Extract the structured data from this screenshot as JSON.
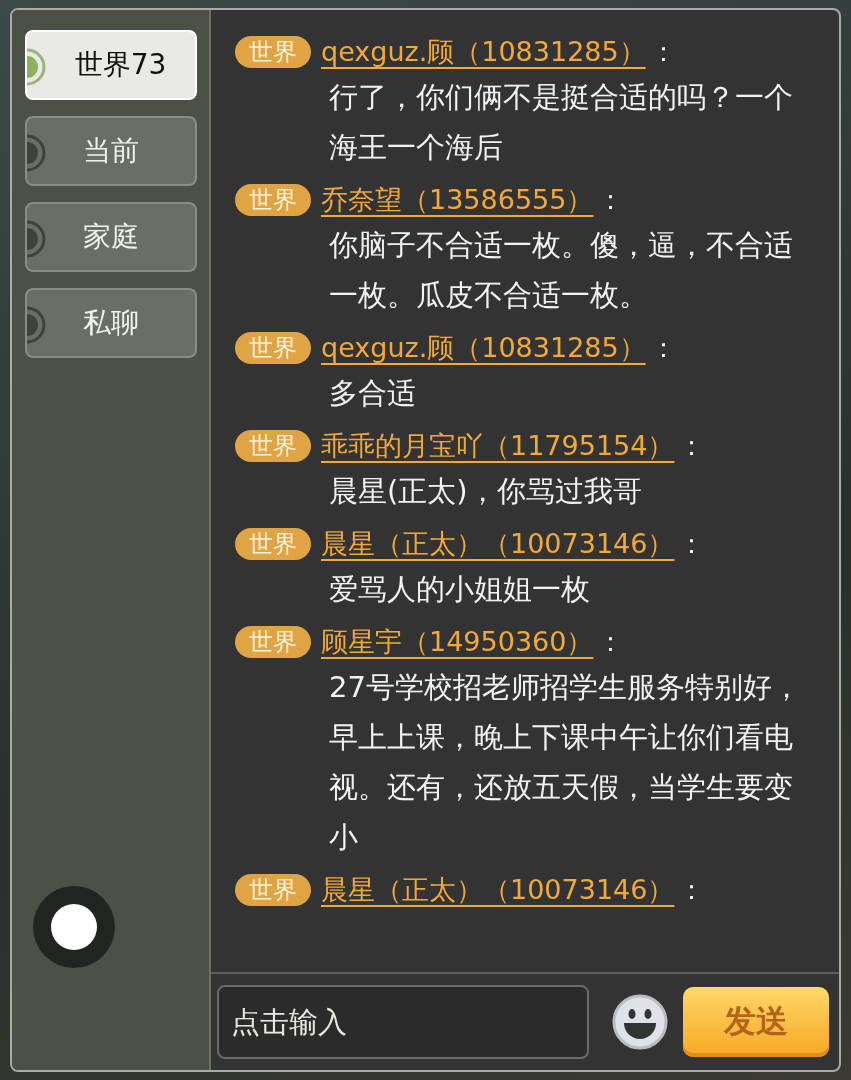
{
  "tabs": [
    {
      "label": "世界73",
      "selected": true
    },
    {
      "label": "当前",
      "selected": false
    },
    {
      "label": "家庭",
      "selected": false
    },
    {
      "label": "私聊",
      "selected": false
    }
  ],
  "messages": [
    {
      "channel": "世界",
      "sender": "qexguz.顾（10831285）",
      "colon": "：",
      "text": "行了，你们俩不是挺合适的吗？一个海王一个海后"
    },
    {
      "channel": "世界",
      "sender": "乔奈望（13586555）",
      "colon": "：",
      "text": "你脑子不合适一枚。傻，逼，不合适一枚。瓜皮不合适一枚。"
    },
    {
      "channel": "世界",
      "sender": "qexguz.顾（10831285）",
      "colon": "：",
      "text": "多合适"
    },
    {
      "channel": "世界",
      "sender": "乖乖的月宝吖（11795154）",
      "colon": "：",
      "text": "晨星(正太)，你骂过我哥"
    },
    {
      "channel": "世界",
      "sender": "晨星（正太）（10073146）",
      "colon": "：",
      "text": "爱骂人的小姐姐一枚"
    },
    {
      "channel": "世界",
      "sender": "顾星宇（14950360）",
      "colon": "：",
      "text": "27号学校招老师招学生服务特别好，早上上课，晚上下课中午让你们看电视。还有，还放五天假，当学生要变小"
    },
    {
      "channel": "世界",
      "sender": "晨星（正太）（10073146）",
      "colon": "："
    }
  ],
  "input": {
    "placeholder": "点击输入"
  },
  "send_button": "发送"
}
